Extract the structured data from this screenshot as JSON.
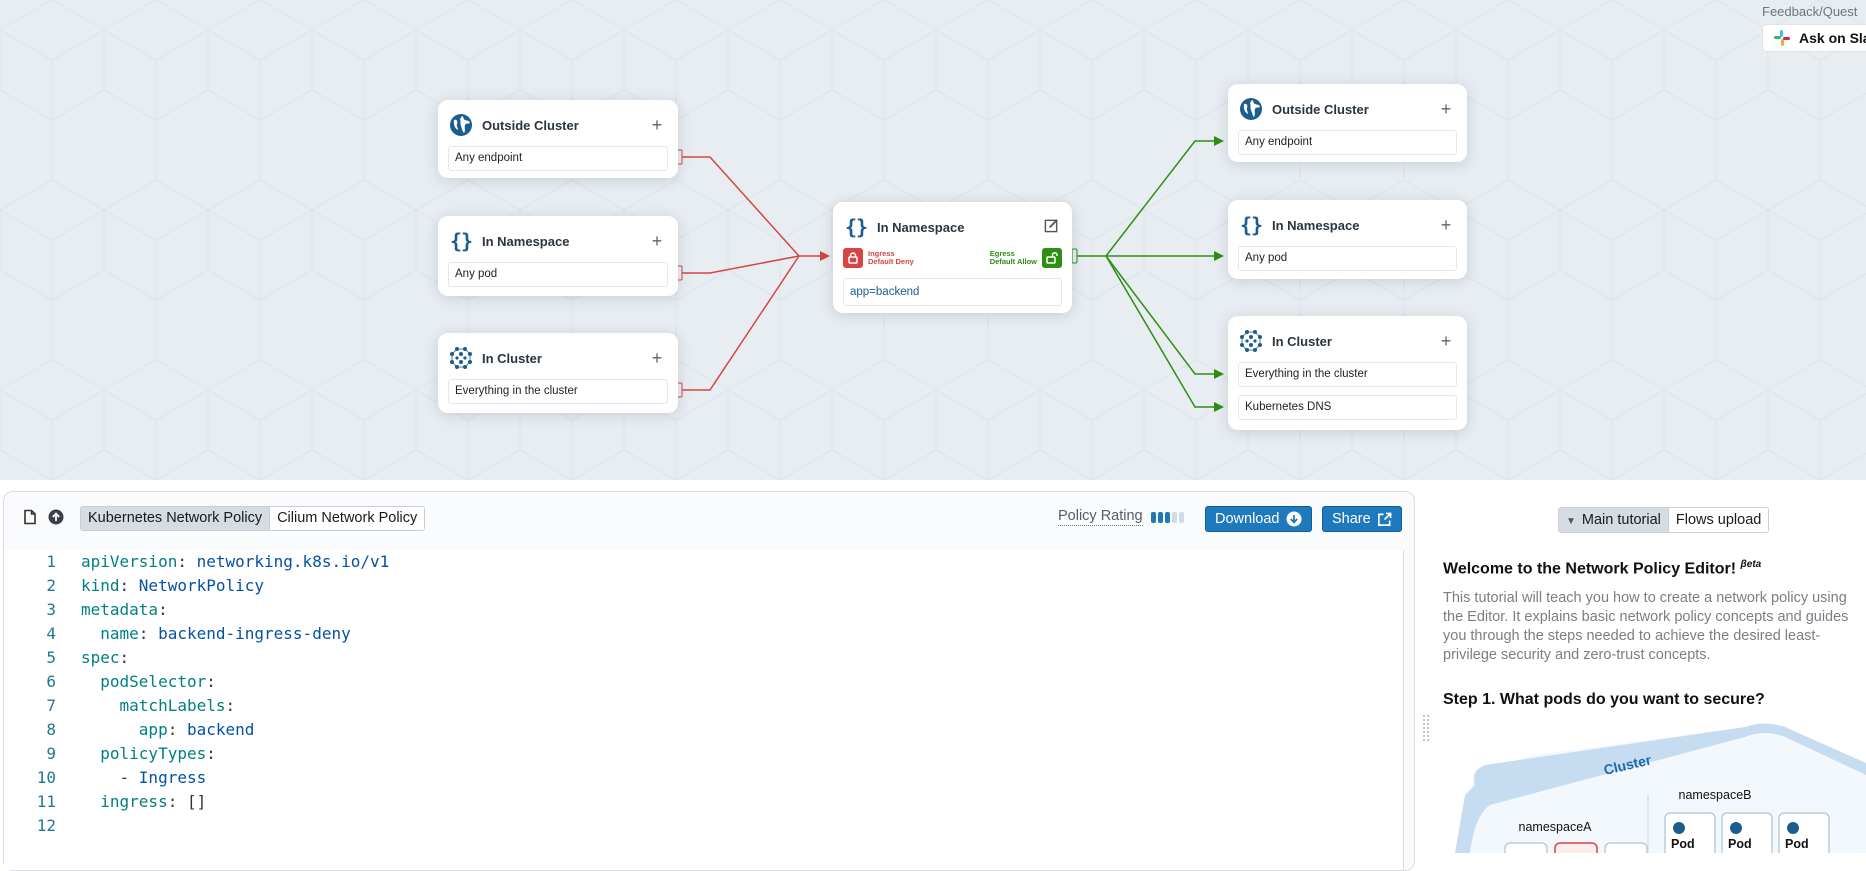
{
  "canvas": {
    "ingress_sources": [
      {
        "title": "Outside Cluster",
        "icon": "globe-icon",
        "rules": [
          "Any endpoint"
        ]
      },
      {
        "title": "In Namespace",
        "icon": "namespace-braces-icon",
        "rules": [
          "Any pod"
        ]
      },
      {
        "title": "In Cluster",
        "icon": "cluster-icon",
        "rules": [
          "Everything in the cluster"
        ]
      }
    ],
    "center": {
      "title": "In Namespace",
      "ingress_label": "Ingress",
      "ingress_status": "Default Deny",
      "egress_label": "Egress",
      "egress_status": "Default Allow",
      "selector": "app=backend"
    },
    "egress_targets": [
      {
        "title": "Outside Cluster",
        "icon": "globe-icon",
        "rules": [
          "Any endpoint"
        ]
      },
      {
        "title": "In Namespace",
        "icon": "namespace-braces-icon",
        "rules": [
          "Any pod"
        ]
      },
      {
        "title": "In Cluster",
        "icon": "cluster-icon",
        "rules": [
          "Everything in the cluster",
          "Kubernetes DNS"
        ]
      }
    ],
    "colors": {
      "deny": "#d64545",
      "allow": "#2f8e14",
      "brand": "#1c5d8f"
    },
    "feedback_label": "Feedback/Quest",
    "slack_button": "Ask on Sla"
  },
  "toolbar": {
    "policy_tabs": [
      "Kubernetes Network Policy",
      "Cilium Network Policy"
    ],
    "active_tab": "Kubernetes Network Policy",
    "policy_rating_label": "Policy Rating",
    "policy_rating": {
      "value": 3,
      "max": 5
    },
    "download_label": "Download",
    "share_label": "Share"
  },
  "editor": {
    "lines": [
      {
        "n": "1",
        "indent": "",
        "key": "apiVersion",
        "val": "networking.k8s.io/v1"
      },
      {
        "n": "2",
        "indent": "",
        "key": "kind",
        "val": "NetworkPolicy"
      },
      {
        "n": "3",
        "indent": "",
        "key": "metadata",
        "val": ""
      },
      {
        "n": "4",
        "indent": "  ",
        "key": "name",
        "val": "backend-ingress-deny"
      },
      {
        "n": "5",
        "indent": "",
        "key": "spec",
        "val": ""
      },
      {
        "n": "6",
        "indent": "  ",
        "key": "podSelector",
        "val": ""
      },
      {
        "n": "7",
        "indent": "    ",
        "key": "matchLabels",
        "val": ""
      },
      {
        "n": "8",
        "indent": "      ",
        "key": "app",
        "val": "backend"
      },
      {
        "n": "9",
        "indent": "  ",
        "key": "policyTypes",
        "val": ""
      },
      {
        "n": "10",
        "indent": "    ",
        "key": "",
        "val": "Ingress",
        "list": true
      },
      {
        "n": "11",
        "indent": "  ",
        "key": "ingress",
        "val": "[]"
      },
      {
        "n": "12",
        "indent": "",
        "key": "",
        "val": ""
      }
    ]
  },
  "tutorial": {
    "tabs": [
      "Main tutorial",
      "Flows upload"
    ],
    "active_tab": "Main tutorial",
    "title": "Welcome to the Network Policy Editor!",
    "title_badge": "βeta",
    "intro": "This tutorial will teach you how to create a network policy using the Editor. It explains basic network policy concepts and guides you through the steps needed to achieve the desired least-privilege security and zero-trust concepts.",
    "step1": "Step 1. What pods do you want to secure?",
    "illustration": {
      "cluster_label": "Cluster",
      "namespace_a": "namespaceA",
      "namespace_b": "namespaceB",
      "pod_label": "Pod"
    }
  }
}
